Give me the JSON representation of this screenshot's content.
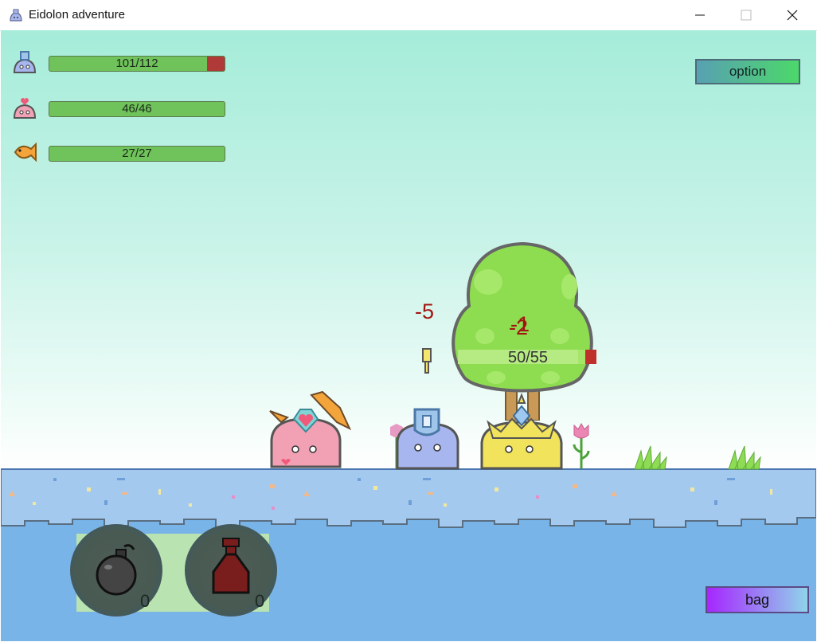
{
  "window": {
    "title": "Eidolon adventure"
  },
  "party": [
    {
      "icon": "blue-slime-icon",
      "hp_text": "101/112",
      "hp_fraction": 0.9018,
      "color": "#a7b6ee"
    },
    {
      "icon": "pink-slime-icon",
      "hp_text": "46/46",
      "hp_fraction": 1.0,
      "color": "#f0a1b4"
    },
    {
      "icon": "fish-icon",
      "hp_text": "27/27",
      "hp_fraction": 1.0,
      "color": "#f3a43a"
    }
  ],
  "buttons": {
    "option_label": "option",
    "bag_label": "bag"
  },
  "enemy": {
    "name": "tree",
    "hp_text": "50/55",
    "hp_fraction": 0.9091
  },
  "damage_numbers": {
    "left": "-5",
    "on_enemy_1": "-1",
    "on_enemy_2": "-2"
  },
  "items": [
    {
      "icon": "bomb-icon",
      "count": "0"
    },
    {
      "icon": "potion-icon",
      "count": "0"
    }
  ],
  "colors": {
    "hp_green": "#6fc35a",
    "hp_red": "#b03a37",
    "water": "#79b4e8",
    "ground": "#a4c9ef"
  }
}
